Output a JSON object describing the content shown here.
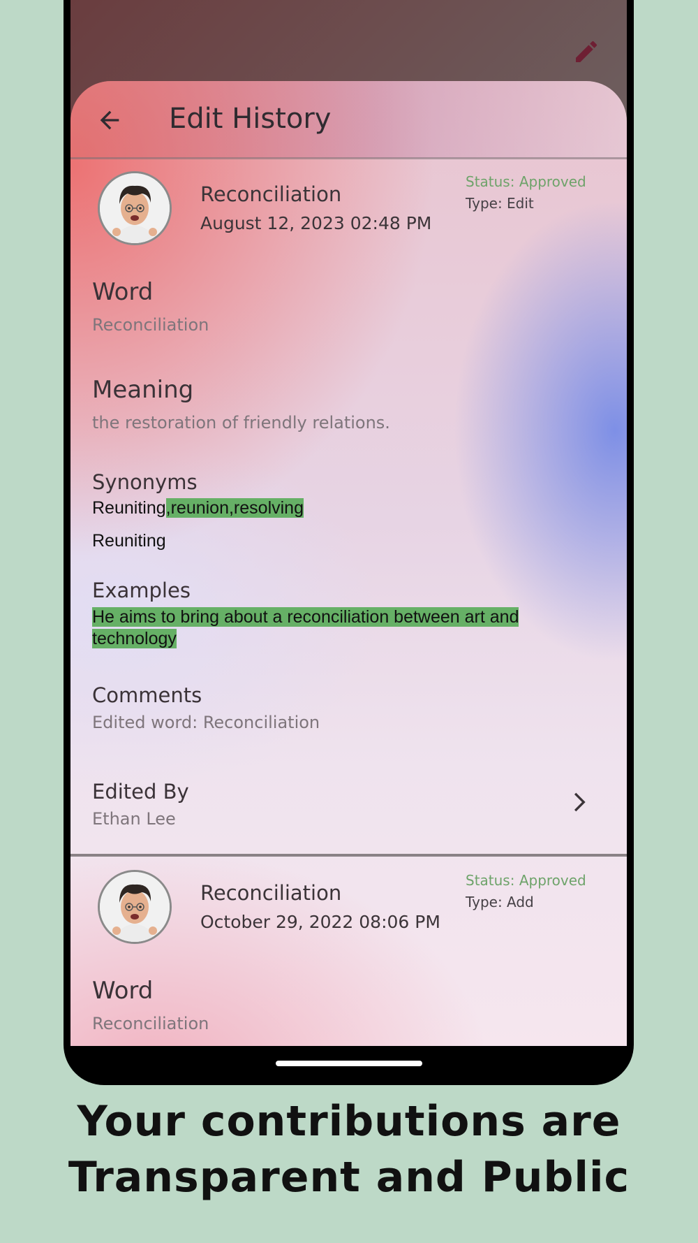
{
  "screen": {
    "title": "Edit History"
  },
  "entries": [
    {
      "word": "Reconciliation",
      "date": "August 12, 2023 02:48 PM",
      "status": "Status: Approved",
      "type": "Type: Edit",
      "word_label": "Word",
      "word_value": "Reconciliation",
      "meaning_label": "Meaning",
      "meaning_value": "the restoration of friendly relations.",
      "synonyms_label": "Synonyms",
      "synonyms_new_plain": "Reuniting",
      "synonyms_new_added": ",reunion,resolving",
      "synonyms_old": "Reuniting",
      "examples_label": "Examples",
      "examples_added": "He aims to bring about a reconciliation between art and technology",
      "comments_label": "Comments",
      "comments_value": "Edited word: Reconciliation",
      "edited_by_label": "Edited By",
      "edited_by_value": "Ethan Lee"
    },
    {
      "word": "Reconciliation",
      "date": "October 29, 2022 08:06 PM",
      "status": "Status: Approved",
      "type": "Type: Add",
      "word_label": "Word",
      "word_value": "Reconciliation"
    }
  ],
  "caption": {
    "line1": "Your contributions are",
    "line2": "Transparent and Public"
  },
  "colors": {
    "background": "#bdd9c7",
    "status_approved": "#6ea36a",
    "added_highlight": "#66b066",
    "edit_icon": "#6e1f33"
  },
  "icons": [
    "edit-pencil-icon",
    "back-arrow-icon",
    "avatar",
    "chevron-right-icon"
  ]
}
